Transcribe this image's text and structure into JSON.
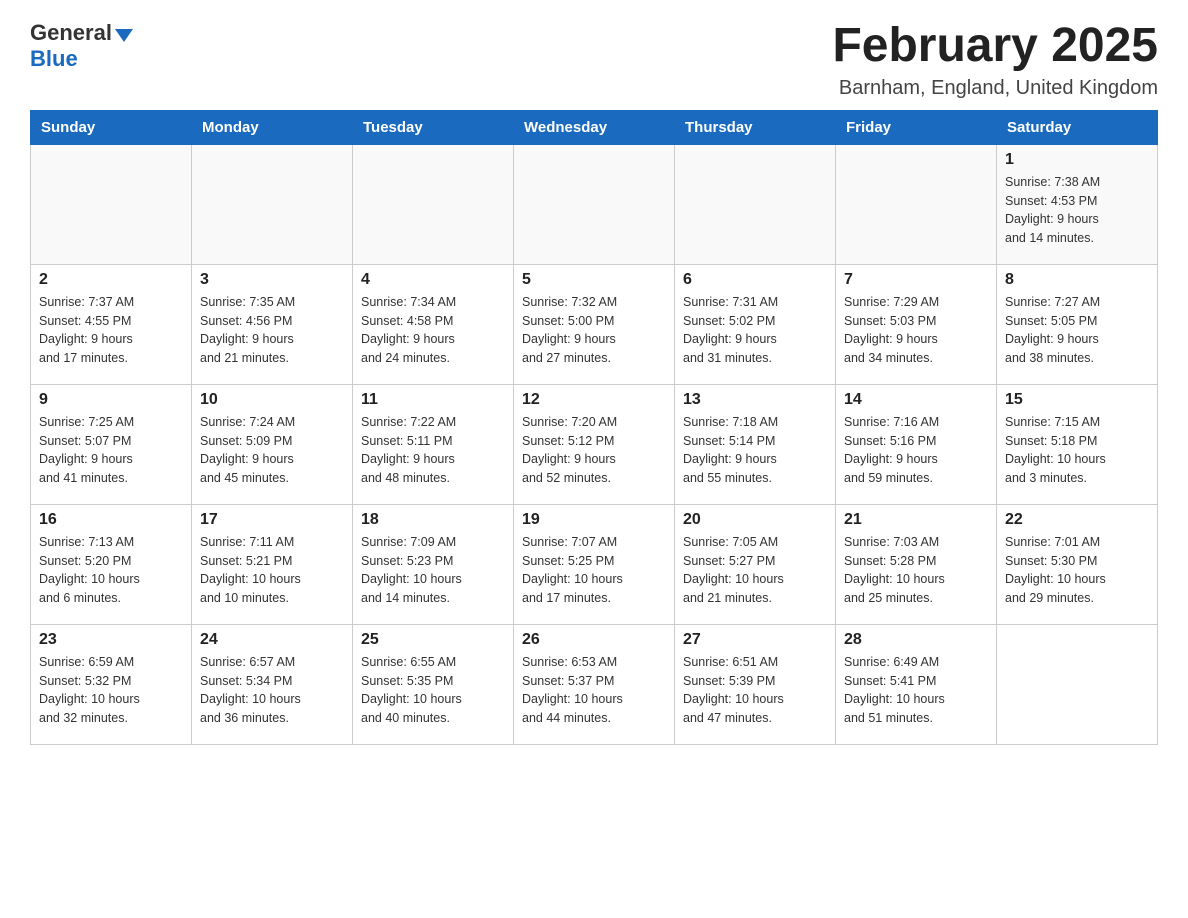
{
  "header": {
    "logo_general": "General",
    "logo_blue": "Blue",
    "title": "February 2025",
    "location": "Barnham, England, United Kingdom"
  },
  "days_of_week": [
    "Sunday",
    "Monday",
    "Tuesday",
    "Wednesday",
    "Thursday",
    "Friday",
    "Saturday"
  ],
  "weeks": [
    [
      {
        "day": "",
        "info": ""
      },
      {
        "day": "",
        "info": ""
      },
      {
        "day": "",
        "info": ""
      },
      {
        "day": "",
        "info": ""
      },
      {
        "day": "",
        "info": ""
      },
      {
        "day": "",
        "info": ""
      },
      {
        "day": "1",
        "info": "Sunrise: 7:38 AM\nSunset: 4:53 PM\nDaylight: 9 hours\nand 14 minutes."
      }
    ],
    [
      {
        "day": "2",
        "info": "Sunrise: 7:37 AM\nSunset: 4:55 PM\nDaylight: 9 hours\nand 17 minutes."
      },
      {
        "day": "3",
        "info": "Sunrise: 7:35 AM\nSunset: 4:56 PM\nDaylight: 9 hours\nand 21 minutes."
      },
      {
        "day": "4",
        "info": "Sunrise: 7:34 AM\nSunset: 4:58 PM\nDaylight: 9 hours\nand 24 minutes."
      },
      {
        "day": "5",
        "info": "Sunrise: 7:32 AM\nSunset: 5:00 PM\nDaylight: 9 hours\nand 27 minutes."
      },
      {
        "day": "6",
        "info": "Sunrise: 7:31 AM\nSunset: 5:02 PM\nDaylight: 9 hours\nand 31 minutes."
      },
      {
        "day": "7",
        "info": "Sunrise: 7:29 AM\nSunset: 5:03 PM\nDaylight: 9 hours\nand 34 minutes."
      },
      {
        "day": "8",
        "info": "Sunrise: 7:27 AM\nSunset: 5:05 PM\nDaylight: 9 hours\nand 38 minutes."
      }
    ],
    [
      {
        "day": "9",
        "info": "Sunrise: 7:25 AM\nSunset: 5:07 PM\nDaylight: 9 hours\nand 41 minutes."
      },
      {
        "day": "10",
        "info": "Sunrise: 7:24 AM\nSunset: 5:09 PM\nDaylight: 9 hours\nand 45 minutes."
      },
      {
        "day": "11",
        "info": "Sunrise: 7:22 AM\nSunset: 5:11 PM\nDaylight: 9 hours\nand 48 minutes."
      },
      {
        "day": "12",
        "info": "Sunrise: 7:20 AM\nSunset: 5:12 PM\nDaylight: 9 hours\nand 52 minutes."
      },
      {
        "day": "13",
        "info": "Sunrise: 7:18 AM\nSunset: 5:14 PM\nDaylight: 9 hours\nand 55 minutes."
      },
      {
        "day": "14",
        "info": "Sunrise: 7:16 AM\nSunset: 5:16 PM\nDaylight: 9 hours\nand 59 minutes."
      },
      {
        "day": "15",
        "info": "Sunrise: 7:15 AM\nSunset: 5:18 PM\nDaylight: 10 hours\nand 3 minutes."
      }
    ],
    [
      {
        "day": "16",
        "info": "Sunrise: 7:13 AM\nSunset: 5:20 PM\nDaylight: 10 hours\nand 6 minutes."
      },
      {
        "day": "17",
        "info": "Sunrise: 7:11 AM\nSunset: 5:21 PM\nDaylight: 10 hours\nand 10 minutes."
      },
      {
        "day": "18",
        "info": "Sunrise: 7:09 AM\nSunset: 5:23 PM\nDaylight: 10 hours\nand 14 minutes."
      },
      {
        "day": "19",
        "info": "Sunrise: 7:07 AM\nSunset: 5:25 PM\nDaylight: 10 hours\nand 17 minutes."
      },
      {
        "day": "20",
        "info": "Sunrise: 7:05 AM\nSunset: 5:27 PM\nDaylight: 10 hours\nand 21 minutes."
      },
      {
        "day": "21",
        "info": "Sunrise: 7:03 AM\nSunset: 5:28 PM\nDaylight: 10 hours\nand 25 minutes."
      },
      {
        "day": "22",
        "info": "Sunrise: 7:01 AM\nSunset: 5:30 PM\nDaylight: 10 hours\nand 29 minutes."
      }
    ],
    [
      {
        "day": "23",
        "info": "Sunrise: 6:59 AM\nSunset: 5:32 PM\nDaylight: 10 hours\nand 32 minutes."
      },
      {
        "day": "24",
        "info": "Sunrise: 6:57 AM\nSunset: 5:34 PM\nDaylight: 10 hours\nand 36 minutes."
      },
      {
        "day": "25",
        "info": "Sunrise: 6:55 AM\nSunset: 5:35 PM\nDaylight: 10 hours\nand 40 minutes."
      },
      {
        "day": "26",
        "info": "Sunrise: 6:53 AM\nSunset: 5:37 PM\nDaylight: 10 hours\nand 44 minutes."
      },
      {
        "day": "27",
        "info": "Sunrise: 6:51 AM\nSunset: 5:39 PM\nDaylight: 10 hours\nand 47 minutes."
      },
      {
        "day": "28",
        "info": "Sunrise: 6:49 AM\nSunset: 5:41 PM\nDaylight: 10 hours\nand 51 minutes."
      },
      {
        "day": "",
        "info": ""
      }
    ]
  ]
}
